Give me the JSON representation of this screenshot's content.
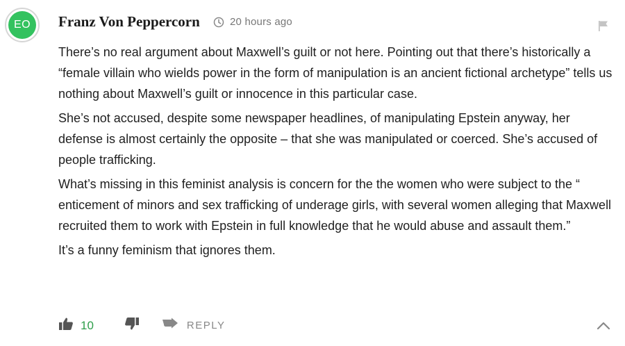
{
  "comment": {
    "avatar_initials": "EO",
    "avatar_color": "#33c25f",
    "author": "Franz Von Peppercorn",
    "timestamp": "20 hours ago",
    "paragraphs": [
      "There’s no real argument about Maxwell’s guilt or not here. Pointing out that there’s historically a “female villain who wields power in the form of manipulation is an ancient fictional archetype” tells us nothing about Maxwell’s guilt or innocence in this particular case.",
      "She’s not accused, despite some newspaper headlines, of manipulating Epstein anyway, her defense is almost certainly the opposite – that she was manipulated or coerced. She’s accused of people trafficking.",
      "What’s missing in this feminist analysis is concern for the the women who were subject to the “ enticement of minors and sex trafficking of underage girls, with several women alleging that Maxwell recruited them to work with Epstein in full knowledge that he would abuse and assault them.”",
      "It’s a funny feminism that ignores them."
    ],
    "actions": {
      "like_count": "10",
      "reply_label": "REPLY"
    },
    "icons": [
      "clock-icon",
      "flag-icon",
      "thumbs-up-icon",
      "thumbs-down-icon",
      "reply-arrow-icon",
      "chevron-up-icon"
    ]
  }
}
